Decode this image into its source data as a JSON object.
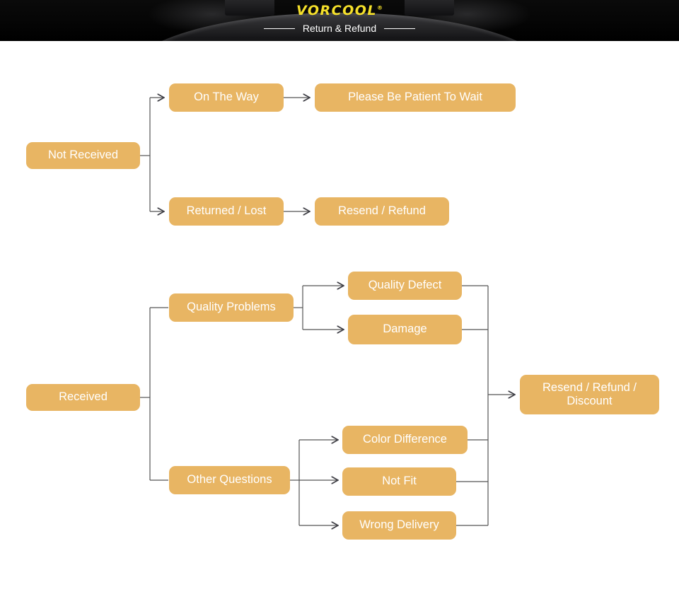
{
  "banner": {
    "logo_text": "VORCOOL",
    "logo_reg": "®",
    "subtitle": "Return & Refund",
    "logo_color": "#f5e02a",
    "background_color": "#000000"
  },
  "theme": {
    "node_fill": "#e8b563",
    "node_text": "#ffffff",
    "connector": "#555555",
    "page_background": "#ffffff"
  },
  "flow": {
    "branch_not_received": {
      "root": "Not Received",
      "level1": [
        {
          "label": "On The Way",
          "result": "Please Be Patient To Wait"
        },
        {
          "label": "Returned / Lost",
          "result": "Resend / Refund"
        }
      ]
    },
    "branch_received": {
      "root": "Received",
      "groups": [
        {
          "label": "Quality Problems",
          "items": [
            "Quality Defect",
            "Damage"
          ]
        },
        {
          "label": "Other Questions",
          "items": [
            "Color Difference",
            "Not Fit",
            "Wrong Delivery"
          ]
        }
      ],
      "outcome": "Resend / Refund / Discount"
    }
  }
}
